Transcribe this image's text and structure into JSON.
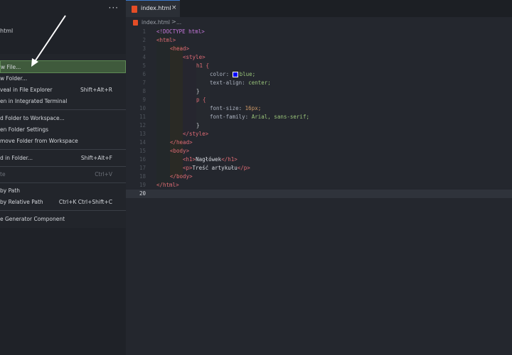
{
  "sidebar": {
    "more_label": "···",
    "file_label": "html"
  },
  "menu": {
    "items": [
      {
        "label": "w File...",
        "shortcut": ""
      },
      {
        "label": "w Folder...",
        "shortcut": ""
      },
      {
        "label": "veal in File Explorer",
        "shortcut": "Shift+Alt+R"
      },
      {
        "label": "en in Integrated Terminal",
        "shortcut": ""
      },
      {
        "label": "d Folder to Workspace...",
        "shortcut": ""
      },
      {
        "label": "en Folder Settings",
        "shortcut": ""
      },
      {
        "label": "move Folder from Workspace",
        "shortcut": ""
      },
      {
        "label": "d in Folder...",
        "shortcut": "Shift+Alt+F"
      },
      {
        "label": "te",
        "shortcut": "Ctrl+V"
      },
      {
        "label": "by Path",
        "shortcut": ""
      },
      {
        "label": "by Relative Path",
        "shortcut": "Ctrl+K Ctrl+Shift+C"
      },
      {
        "label": "e Generator Component",
        "shortcut": ""
      }
    ]
  },
  "tab": {
    "label": "index.html",
    "close": "×"
  },
  "breadcrumb": {
    "file": "index.html",
    "sep": ">",
    "more": "..."
  },
  "code": {
    "line_numbers": [
      "1",
      "2",
      "3",
      "4",
      "5",
      "6",
      "7",
      "8",
      "9",
      "10",
      "11",
      "12",
      "13",
      "14",
      "15",
      "16",
      "17",
      "18",
      "19",
      "20"
    ],
    "doctype": "<!DOCTYPE html>",
    "html_open": "<html>",
    "head_open": "<head>",
    "style_open": "<style>",
    "h1_sel": "h1 {",
    "color_prop": "color:",
    "color_val": "blue;",
    "align_prop": "text-align:",
    "align_val": "center;",
    "close_brace": "}",
    "p_sel": "p {",
    "size_prop": "font-size:",
    "size_val": "16px;",
    "family_prop": "font-family:",
    "family_val": "Arial, sans-serif;",
    "style_close": "</style>",
    "head_close": "</head>",
    "body_open": "<body>",
    "h1_line_open": "<h1>",
    "h1_text": "Nagłówek",
    "h1_line_close": "</h1>",
    "p_line_open": "<p>",
    "p_text": "Treść artykułu",
    "p_line_close": "</p>",
    "body_close": "</body>",
    "html_close": "</html>"
  },
  "colors": {
    "swatch": "#0000ff",
    "active_item": "#3f5a3c"
  }
}
